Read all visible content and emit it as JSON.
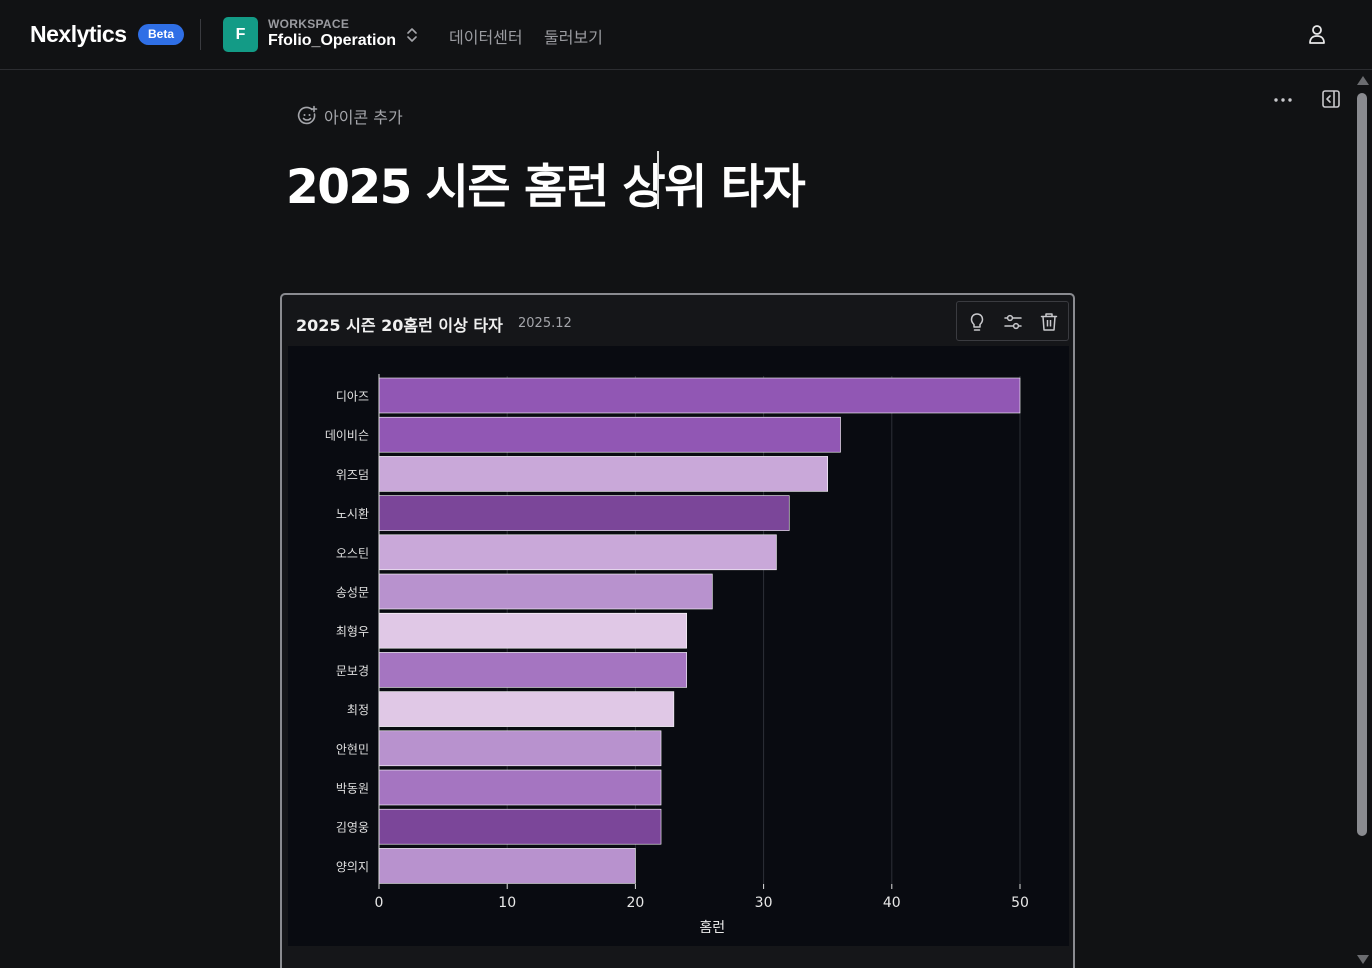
{
  "header": {
    "logo": "Nexlytics",
    "badge": "Beta",
    "workspace_initial": "F",
    "workspace_kicker": "WORKSPACE",
    "workspace_name": "Ffolio_Operation",
    "nav": [
      "데이터센터",
      "둘러보기"
    ]
  },
  "page": {
    "add_icon_label": "아이콘 추가",
    "title": "2025 시즌 홈런 상위 타자"
  },
  "card": {
    "title": "2025 시즌 20홈런 이상 타자",
    "date": "2025.12"
  },
  "colors": {
    "accent": "#2f6fe6",
    "workspace": "#139b86"
  },
  "chart_data": {
    "type": "bar",
    "orientation": "horizontal",
    "categories": [
      "디아즈",
      "데이비슨",
      "위즈덤",
      "노시환",
      "오스틴",
      "송성문",
      "최형우",
      "문보경",
      "최정",
      "안현민",
      "박동원",
      "김영웅",
      "양의지"
    ],
    "values": [
      50,
      36,
      35,
      32,
      31,
      26,
      24,
      24,
      23,
      22,
      22,
      22,
      20
    ],
    "colors": [
      "#9157b4",
      "#9157b4",
      "#c9a8d9",
      "#7b4699",
      "#c9a8d9",
      "#b892ce",
      "#e0c8e6",
      "#a575c1",
      "#e0c8e6",
      "#b892ce",
      "#a575c1",
      "#7b4699",
      "#b892ce"
    ],
    "xlabel": "홈런",
    "ylabel": "",
    "xlim": [
      0,
      52
    ],
    "xticks": [
      0,
      10,
      20,
      30,
      40,
      50
    ],
    "grid": true
  }
}
